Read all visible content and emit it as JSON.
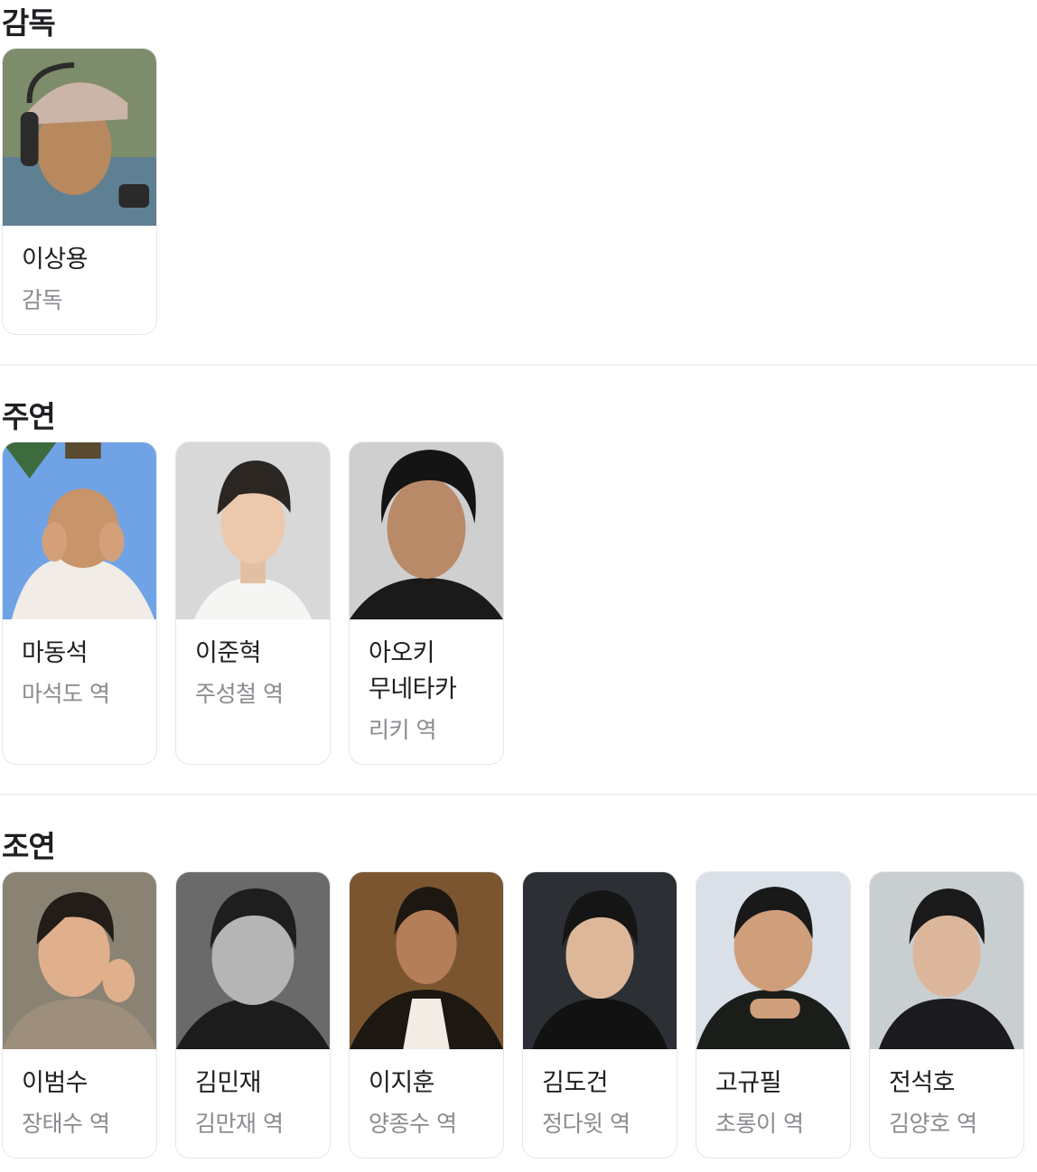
{
  "sections": {
    "director": {
      "title": "감독",
      "people": [
        {
          "name": "이상용",
          "role": "감독"
        }
      ]
    },
    "main": {
      "title": "주연",
      "people": [
        {
          "name": "마동석",
          "role": "마석도 역"
        },
        {
          "name": "이준혁",
          "role": "주성철 역"
        },
        {
          "name": "아오키 무네타카",
          "role": "리키 역"
        }
      ]
    },
    "supporting": {
      "title": "조연",
      "people": [
        {
          "name": "이범수",
          "role": "장태수 역"
        },
        {
          "name": "김민재",
          "role": "김만재 역"
        },
        {
          "name": "이지훈",
          "role": "양종수 역"
        },
        {
          "name": "김도건",
          "role": "정다윗 역"
        },
        {
          "name": "고규필",
          "role": "초롱이 역"
        },
        {
          "name": "전석호",
          "role": "김양호 역"
        }
      ]
    }
  }
}
